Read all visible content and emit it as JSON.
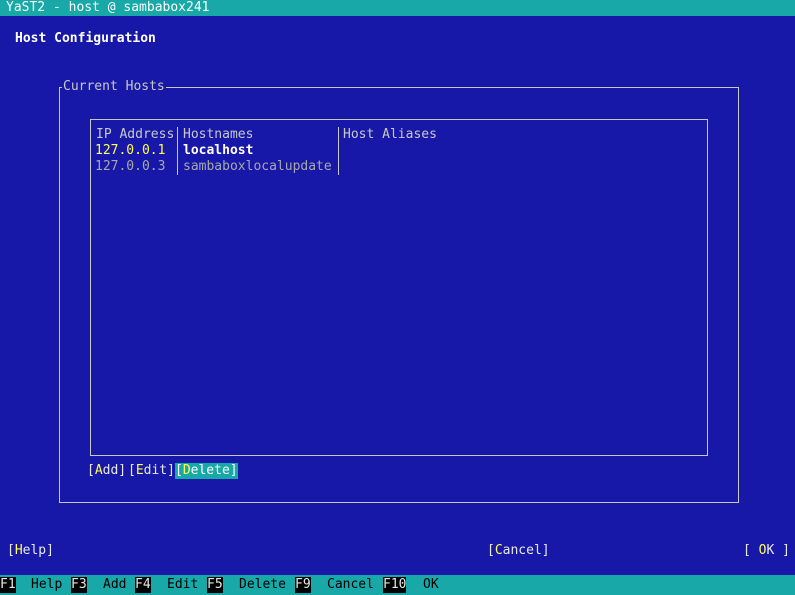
{
  "window": {
    "title": "YaST2 - host @ sambabox241"
  },
  "page": {
    "title": "Host Configuration"
  },
  "hosts_frame": {
    "label": "Current Hosts",
    "columns": [
      "IP Address",
      "Hostnames",
      "Host Aliases"
    ],
    "rows": [
      {
        "ip": "127.0.0.1",
        "hostname": "localhost",
        "aliases": ""
      },
      {
        "ip": "127.0.0.3",
        "hostname": "sambaboxlocalupdate",
        "aliases": ""
      }
    ],
    "selected_row": 0
  },
  "actions": {
    "add": {
      "pre": "[",
      "hot": "A",
      "post": "dd]"
    },
    "edit": {
      "pre": "[",
      "hot": "E",
      "post": "dit]"
    },
    "delete": {
      "pre": "[",
      "hot": "D",
      "post": "elete]"
    }
  },
  "dialog_buttons": {
    "help": {
      "pre": "[",
      "hot": "H",
      "post": "elp]"
    },
    "cancel": {
      "pre": "[",
      "hot": "C",
      "post": "ancel]"
    },
    "ok": {
      "pre": "[ ",
      "hot": "O",
      "post": "K ]"
    }
  },
  "function_keys": [
    {
      "key": "F1",
      "label": "Help"
    },
    {
      "key": "F3",
      "label": "Add"
    },
    {
      "key": "F4",
      "label": "Edit"
    },
    {
      "key": "F5",
      "label": "Delete"
    },
    {
      "key": "F9",
      "label": "Cancel"
    },
    {
      "key": "F10",
      "label": "OK"
    }
  ],
  "colors": {
    "background": "#1818a8",
    "title_bar": "#18a8a8",
    "hotkey": "#ffff54",
    "focus": "#18a8a8"
  }
}
